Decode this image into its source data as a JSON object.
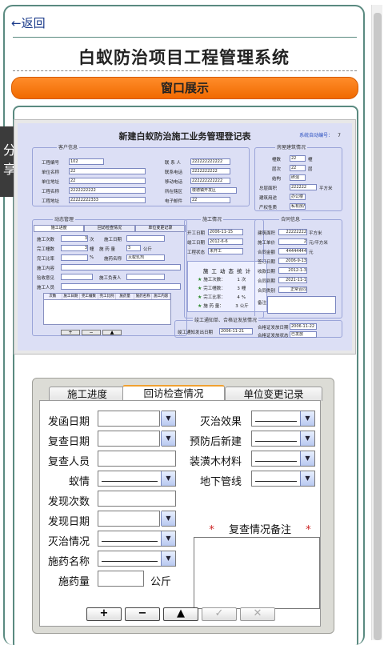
{
  "nav": {
    "back_label": "←返回"
  },
  "page": {
    "title": "白蚁防治项目工程管理系统",
    "section_title": "窗口展示"
  },
  "share_label": "分享",
  "screenshot1": {
    "title": "新建白蚁防治施工业务管理登记表",
    "auto_no_label": "系统自动编号：",
    "auto_no": "7",
    "customer": {
      "legend": "客户信息",
      "fields": [
        {
          "label": "工程编号",
          "value": "102"
        },
        {
          "label": "单位名称",
          "value": "22"
        },
        {
          "label": "单位地址",
          "value": "22"
        },
        {
          "label": "工程名称",
          "value": "2222222222"
        },
        {
          "label": "工程地址",
          "value": "22222222333"
        }
      ],
      "fields_right": [
        {
          "label": "联 系 人",
          "value": "222222222222"
        },
        {
          "label": "联系电话",
          "value": "2222222222"
        },
        {
          "label": "移动电话",
          "value": "222222222222"
        },
        {
          "label": "所在辖区",
          "value": "楼德镇开发区"
        },
        {
          "label": "电子邮件",
          "value": "22"
        }
      ]
    },
    "building": {
      "legend": "房屋建筑情况",
      "fields": [
        {
          "label": "幢数",
          "value": "22",
          "unit": "幢"
        },
        {
          "label": "层次",
          "value": "22",
          "unit": "层"
        },
        {
          "label": "结构",
          "value": "砖混"
        },
        {
          "label": "总层面积",
          "value": "222222",
          "unit": "平方米"
        },
        {
          "label": "建筑用途",
          "value": "办公楼"
        },
        {
          "label": "产权性质",
          "value": "私有房产"
        }
      ]
    },
    "dynamic": {
      "legend": "动态管理",
      "tabs": [
        "施工进度",
        "回访检查情况",
        "单位变更记录"
      ],
      "rows": [
        {
          "label": "施工次数",
          "value": "3",
          "unit": "次",
          "label2": "施工日期"
        },
        {
          "label": "完工幢数",
          "value": "3",
          "unit": "幢",
          "label2": "施 药 量",
          "value2": "3",
          "unit2": "公斤"
        },
        {
          "label": "完工比率",
          "value": "",
          "unit": "%",
          "label2": "施药名称",
          "value2": "灭蚁乳剂"
        },
        {
          "label": "施工内容"
        },
        {
          "label": "验收意见",
          "label2": "施工负责人"
        },
        {
          "label": "施工人员"
        }
      ],
      "grid_cols": [
        "次数",
        "施工日期",
        "完工幢数",
        "完工比例",
        "施药量",
        "施药名称",
        "施工内容"
      ]
    },
    "construction": {
      "legend": "施工情况",
      "fields": [
        {
          "label": "开工日期",
          "value": "2006-11-15"
        },
        {
          "label": "竣工日期",
          "value": "2012-6-6"
        },
        {
          "label": "工程状态",
          "value": "未开工"
        }
      ],
      "stats_title": "施 工 动 态 统 计",
      "stats": [
        {
          "label": "施工次数：",
          "value": "1",
          "unit": "次"
        },
        {
          "label": "完工幢数：",
          "value": "3",
          "unit": "幢"
        },
        {
          "label": "完工比率：",
          "value": "4",
          "unit": "%"
        },
        {
          "label": "施 药 量：",
          "value": "3",
          "unit": "公斤"
        }
      ]
    },
    "contract": {
      "legend": "合同信息",
      "fields": [
        {
          "label": "建筑面积",
          "value": "22222222",
          "unit": "平方米"
        },
        {
          "label": "施工单价",
          "value": "2",
          "unit": "元/平方米"
        },
        {
          "label": "合同金额",
          "value": "44444444",
          "unit": "元"
        },
        {
          "label": "签订日期",
          "value": "2006-9-13"
        },
        {
          "label": "收款日期",
          "value": "2012-1-3"
        },
        {
          "label": "合同到期",
          "value": "2021-11-1"
        },
        {
          "label": "合同类别",
          "value": "正常合同"
        }
      ],
      "remark_label": "备注"
    },
    "notice": {
      "legend": "竣工通知单、合格证发放情况",
      "label": "竣工通知发出日期",
      "value": "2006-11-21",
      "fields": [
        {
          "label": "合格证发放日期",
          "value": "2006-11-22"
        },
        {
          "label": "合格证发放状态",
          "value": "已发放"
        }
      ]
    }
  },
  "screenshot2": {
    "tabs": [
      "施工进度",
      "回访检查情况",
      "单位变更记录"
    ],
    "active_tab": 1,
    "left_fields": [
      {
        "label": "发函日期",
        "type": "date"
      },
      {
        "label": "复查日期",
        "type": "date"
      },
      {
        "label": "复查人员",
        "type": "text"
      },
      {
        "label": "蚁情",
        "type": "select"
      },
      {
        "label": "发现次数",
        "type": "text"
      },
      {
        "label": "发现日期",
        "type": "date"
      },
      {
        "label": "灭治情况",
        "type": "select"
      },
      {
        "label": "施药名称",
        "type": "select"
      },
      {
        "label": "施药量",
        "type": "text",
        "unit": "公斤"
      }
    ],
    "right_fields": [
      {
        "label": "灭治效果"
      },
      {
        "label": "预防后新建"
      },
      {
        "label": "装潢木材料"
      },
      {
        "label": "地下管线"
      }
    ],
    "notes_title": "复查情况备注",
    "notes_star": "*",
    "buttons": {
      "add": "+",
      "remove": "−",
      "up": "▲",
      "confirm": "✓",
      "cancel": "✕"
    }
  }
}
